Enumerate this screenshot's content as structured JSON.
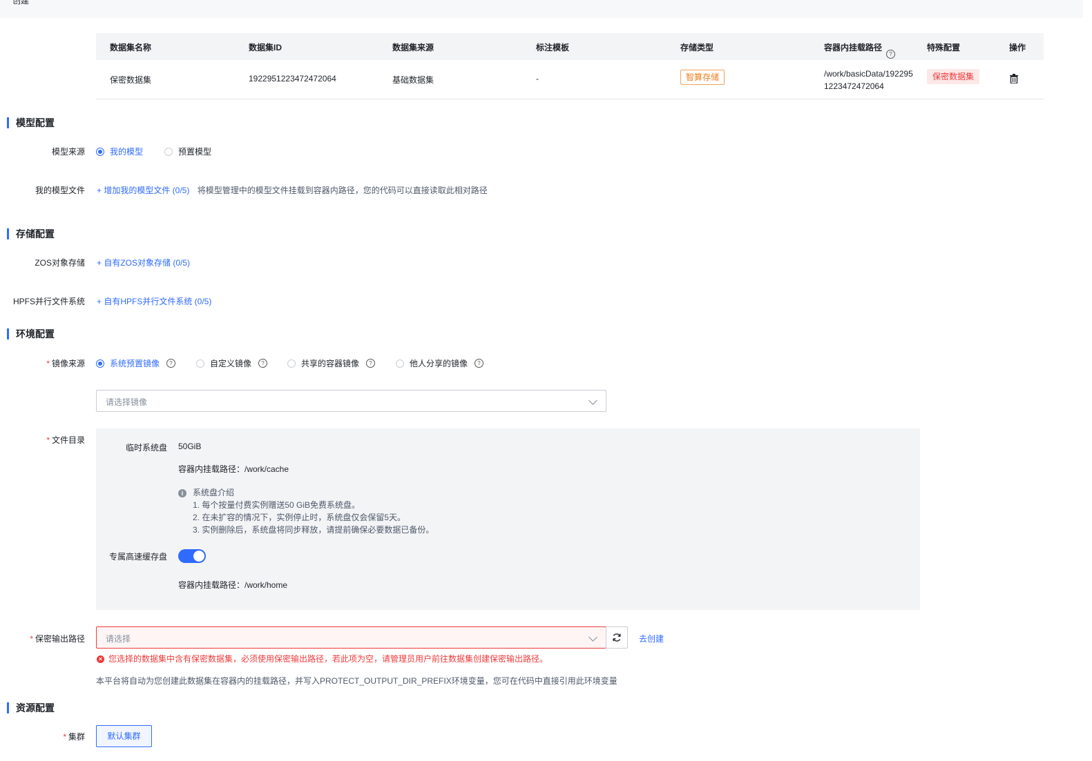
{
  "header": {
    "title": "创建"
  },
  "dataset_table": {
    "headers": {
      "name": "数据集名称",
      "id": "数据集ID",
      "source": "数据集来源",
      "template": "标注模板",
      "storage": "存储类型",
      "mount_path": "容器内挂载路径",
      "special": "特殊配置",
      "action": "操作"
    },
    "rows": [
      {
        "name": "保密数据集",
        "id": "1922951223472472064",
        "source": "基础数据集",
        "template": "-",
        "storage": "智算存储",
        "mount_path_line1": "/work/basicData/192295",
        "mount_path_line2": "1223472472064",
        "special": "保密数据集"
      }
    ]
  },
  "model_config": {
    "title": "模型配置",
    "source_label": "模型来源",
    "source_options": [
      "我的模型",
      "预置模型"
    ],
    "source_selected": "我的模型",
    "files_label": "我的模型文件",
    "add_files_link": "+ 增加我的模型文件 (0/5)",
    "files_hint": "将模型管理中的模型文件挂载到容器内路径，您的代码可以直接读取此相对路径"
  },
  "storage_config": {
    "title": "存储配置",
    "zos_label": "ZOS对象存储",
    "zos_link": "+ 自有ZOS对象存储 (0/5)",
    "hpfs_label": "HPFS并行文件系统",
    "hpfs_link": "+ 自有HPFS并行文件系统 (0/5)"
  },
  "env_config": {
    "title": "环境配置",
    "image_source_label": "镜像来源",
    "image_options": [
      "系统预置镜像",
      "自定义镜像",
      "共享的容器镜像",
      "他人分享的镜像"
    ],
    "image_selected": "系统预置镜像",
    "image_select_placeholder": "请选择镜像",
    "file_dir_label": "文件目录",
    "temp_disk_label": "临时系统盘",
    "temp_disk_value": "50GiB",
    "temp_disk_mount": "容器内挂载路径：/work/cache",
    "disk_intro_title": "系统盘介绍",
    "disk_intro_items": [
      "1. 每个按量付费实例赠送50 GiB免费系统盘。",
      "2. 在未扩容的情况下，实例停止时，系统盘仅会保留5天。",
      "3. 实例删除后，系统盘将同步释放，请提前确保必要数据已备份。"
    ],
    "cache_disk_label": "专属高速缓存盘",
    "cache_disk_enabled": true,
    "cache_disk_mount": "容器内挂载路径：/work/home",
    "output_path_label": "保密输出路径",
    "output_path_placeholder": "请选择",
    "create_link": "去创建",
    "output_error": "您选择的数据集中含有保密数据集，必须使用保密输出路径，若此项为空，请管理员用户前往数据集创建保密输出路径。",
    "output_note": "本平台将自动为您创建此数据集在容器内的挂载路径，并写入PROTECT_OUTPUT_DIR_PREFIX环境变量，您可在代码中直接引用此环境变量"
  },
  "resource_config": {
    "title": "资源配置",
    "cluster_label": "集群",
    "cluster_button": "默认集群"
  },
  "colors": {
    "primary": "#2f6bff",
    "error": "#ee3b3b",
    "warning": "#f07b1c"
  }
}
